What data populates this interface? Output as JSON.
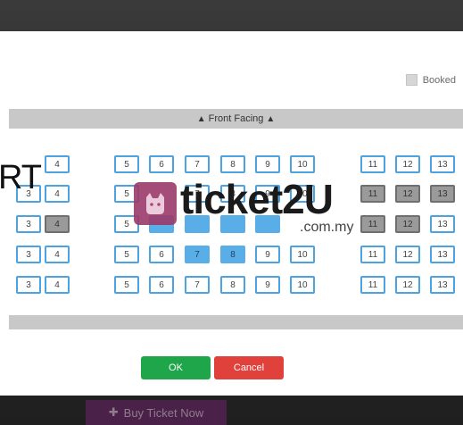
{
  "legend": {
    "booked_label": "Booked"
  },
  "front_bar": {
    "label": "Front Facing"
  },
  "overlay_text": "RT",
  "watermark": {
    "brand": "ticket2U",
    "domain": ".com.my"
  },
  "buttons": {
    "ok": "OK",
    "cancel": "Cancel",
    "buy": "Buy Ticket Now"
  },
  "colors": {
    "seat_border": "#4da3e0",
    "selected": "#5aaee8",
    "booked": "#9a9a9a",
    "ok": "#1fa64a",
    "cancel": "#e0413b",
    "buy": "#4a2148"
  },
  "rows": [
    {
      "seats": [
        {
          "label": "4",
          "state": "available"
        },
        {
          "label": "5",
          "state": "available"
        },
        {
          "label": "6",
          "state": "available"
        },
        {
          "label": "7",
          "state": "available"
        },
        {
          "label": "8",
          "state": "available"
        },
        {
          "label": "9",
          "state": "available"
        },
        {
          "label": "10",
          "state": "available"
        },
        {
          "label": "11",
          "state": "available"
        },
        {
          "label": "12",
          "state": "available"
        },
        {
          "label": "13",
          "state": "available"
        }
      ]
    },
    {
      "seats": [
        {
          "label": "3",
          "state": "available"
        },
        {
          "label": "4",
          "state": "available"
        },
        {
          "label": "5",
          "state": "available"
        },
        {
          "label": "7",
          "state": "available"
        },
        {
          "label": "8",
          "state": "available"
        },
        {
          "label": "9",
          "state": "available"
        },
        {
          "label": "10",
          "state": "available"
        },
        {
          "label": "11",
          "state": "booked"
        },
        {
          "label": "12",
          "state": "booked"
        },
        {
          "label": "13",
          "state": "booked"
        }
      ]
    },
    {
      "seats": [
        {
          "label": "3",
          "state": "available"
        },
        {
          "label": "4",
          "state": "booked"
        },
        {
          "label": "5",
          "state": "available"
        },
        {
          "label": "11",
          "state": "booked"
        },
        {
          "label": "12",
          "state": "booked"
        },
        {
          "label": "13",
          "state": "available"
        }
      ]
    },
    {
      "seats": [
        {
          "label": "3",
          "state": "available"
        },
        {
          "label": "4",
          "state": "available"
        },
        {
          "label": "5",
          "state": "available"
        },
        {
          "label": "6",
          "state": "available"
        },
        {
          "label": "7",
          "state": "selected"
        },
        {
          "label": "8",
          "state": "selected"
        },
        {
          "label": "9",
          "state": "available"
        },
        {
          "label": "10",
          "state": "available"
        },
        {
          "label": "11",
          "state": "available"
        },
        {
          "label": "12",
          "state": "available"
        },
        {
          "label": "13",
          "state": "available"
        }
      ]
    },
    {
      "seats": [
        {
          "label": "3",
          "state": "available"
        },
        {
          "label": "4",
          "state": "available"
        },
        {
          "label": "5",
          "state": "available"
        },
        {
          "label": "6",
          "state": "available"
        },
        {
          "label": "7",
          "state": "available"
        },
        {
          "label": "8",
          "state": "available"
        },
        {
          "label": "9",
          "state": "available"
        },
        {
          "label": "10",
          "state": "available"
        },
        {
          "label": "11",
          "state": "available"
        },
        {
          "label": "12",
          "state": "available"
        },
        {
          "label": "13",
          "state": "available"
        }
      ]
    }
  ]
}
